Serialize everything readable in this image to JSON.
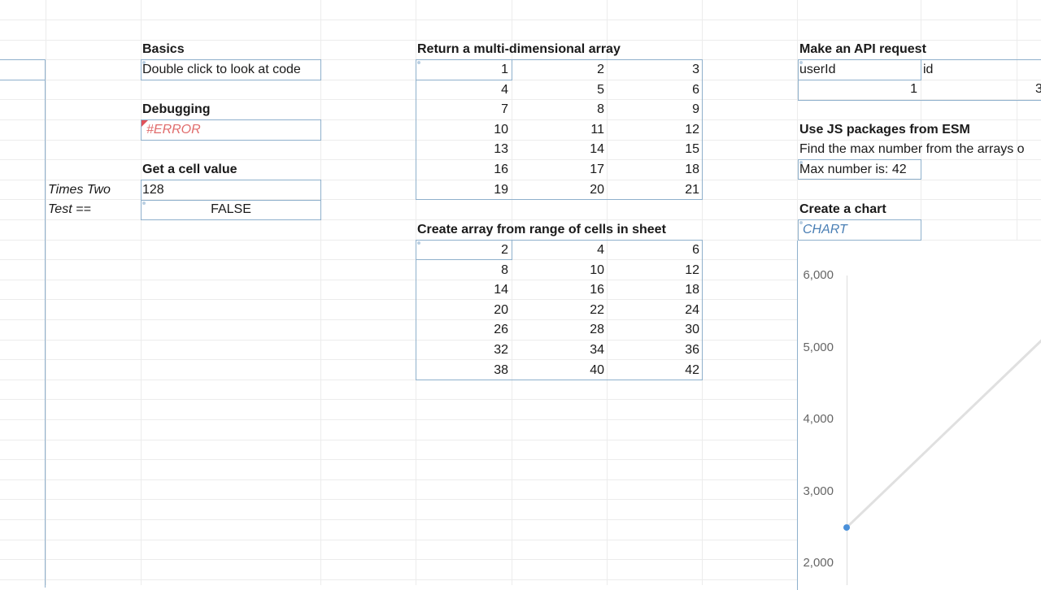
{
  "side_labels": {
    "times_two": "Times Two",
    "test_eq": "Test =="
  },
  "basics": {
    "title": "Basics",
    "cell": "Double click to look at code"
  },
  "debugging": {
    "title": "Debugging",
    "cell": "#ERROR"
  },
  "cell_value": {
    "title": "Get a cell value",
    "times_two_value": "128",
    "test_value": "FALSE"
  },
  "multi_array": {
    "title": "Return a multi-dimensional array",
    "rows": [
      [
        "1",
        "2",
        "3"
      ],
      [
        "4",
        "5",
        "6"
      ],
      [
        "7",
        "8",
        "9"
      ],
      [
        "10",
        "11",
        "12"
      ],
      [
        "13",
        "14",
        "15"
      ],
      [
        "16",
        "17",
        "18"
      ],
      [
        "19",
        "20",
        "21"
      ]
    ]
  },
  "range_array": {
    "title": "Create array from range of cells in sheet",
    "rows": [
      [
        "2",
        "4",
        "6"
      ],
      [
        "8",
        "10",
        "12"
      ],
      [
        "14",
        "16",
        "18"
      ],
      [
        "20",
        "22",
        "24"
      ],
      [
        "26",
        "28",
        "30"
      ],
      [
        "32",
        "34",
        "36"
      ],
      [
        "38",
        "40",
        "42"
      ]
    ]
  },
  "api": {
    "title": "Make an API request",
    "col1": "userId",
    "col2": "id",
    "val1": "1",
    "val2": "3"
  },
  "esm": {
    "title": "Use JS packages from ESM",
    "desc": "Find the max number from the arrays o",
    "result": "Max number is: 42"
  },
  "chart_section": {
    "title": "Create a chart",
    "cell": "CHART"
  },
  "chart_data": {
    "type": "line",
    "y_ticks": [
      "6,000",
      "5,000",
      "4,000",
      "3,000",
      "2,000"
    ],
    "y_tick_values": [
      6000,
      5000,
      4000,
      3000,
      2000
    ],
    "series": [
      {
        "values": [
          2500,
          5200
        ]
      }
    ],
    "point_color": "#4a90d9",
    "line_color": "#e0e0e0"
  }
}
